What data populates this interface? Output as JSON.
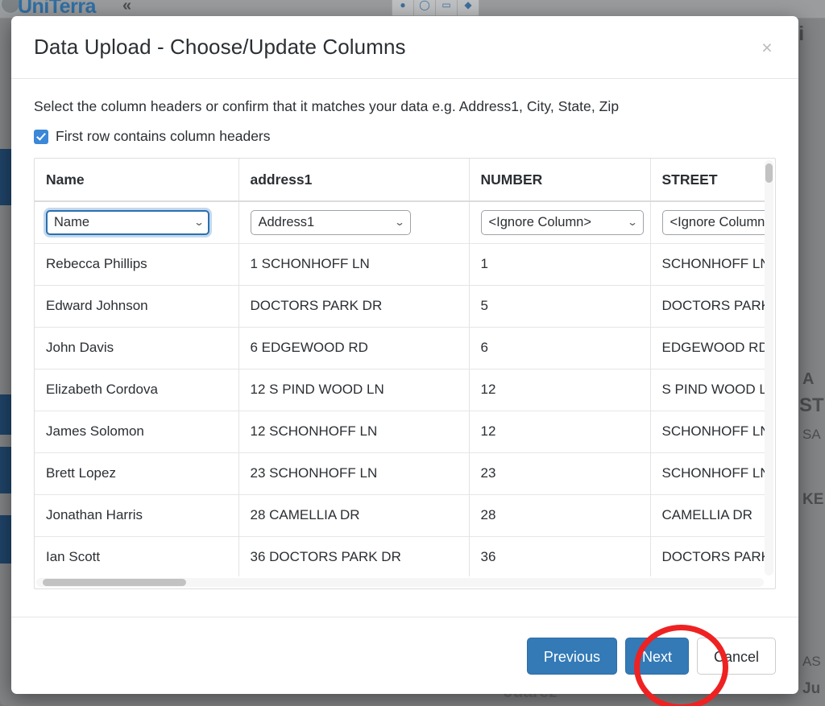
{
  "background": {
    "app_logo": "UniTerra",
    "collapse_icon": "double-chevron-left-icon",
    "toolbar_icons": [
      "pin-icon",
      "circle-icon",
      "rectangle-icon",
      "bookmark-icon"
    ],
    "map_labels": [
      "Vi",
      "A",
      "ST",
      "SA",
      "KE",
      "AS",
      "Ju",
      "Juarez"
    ]
  },
  "modal": {
    "title": "Data Upload - Choose/Update Columns",
    "close_label": "×",
    "instruction": "Select the column headers or confirm that it matches your data e.g. Address1, City, State, Zip",
    "checkbox": {
      "label": "First row contains column headers",
      "checked": true
    },
    "table": {
      "headers": [
        "Name",
        "address1",
        "NUMBER",
        "STREET",
        ""
      ],
      "mapping_selects": [
        {
          "value": "Name",
          "focused": true
        },
        {
          "value": "Address1",
          "focused": false
        },
        {
          "value": "<Ignore Column>",
          "focused": false
        },
        {
          "value": "<Ignore Column>",
          "focused": false
        }
      ],
      "rows": [
        [
          "Rebecca Phillips",
          "1 SCHONHOFF LN",
          "1",
          "SCHONHOFF LN",
          ""
        ],
        [
          "Edward Johnson",
          "DOCTORS PARK DR",
          "5",
          "DOCTORS PARK DR",
          ""
        ],
        [
          "John Davis",
          "6 EDGEWOOD RD",
          "6",
          "EDGEWOOD RD",
          ""
        ],
        [
          "Elizabeth Cordova",
          "12 S PIND WOOD LN",
          "12",
          "S PIND WOOD LN",
          ""
        ],
        [
          "James Solomon",
          "12 SCHONHOFF LN",
          "12",
          "SCHONHOFF LN",
          ""
        ],
        [
          "Brett Lopez",
          "23 SCHONHOFF LN",
          "23",
          "SCHONHOFF LN",
          ""
        ],
        [
          "Jonathan Harris",
          "28 CAMELLIA DR",
          "28",
          "CAMELLIA DR",
          ""
        ],
        [
          "Ian Scott",
          "36 DOCTORS PARK DR",
          "36",
          "DOCTORS PARK DR",
          ""
        ]
      ]
    },
    "footer": {
      "previous_label": "Previous",
      "next_label": "Next",
      "cancel_label": "Cancel"
    }
  },
  "annotation": {
    "type": "red-ellipse-highlight",
    "target": "next-button",
    "color": "#ee2222"
  },
  "colors": {
    "primary_button": "#337ab7",
    "checkbox": "#3b87d8",
    "focus_ring": "#2a6fae",
    "annotation": "#ee2222",
    "logo": "#2f6fa5",
    "sidebar": "#1f4469"
  }
}
